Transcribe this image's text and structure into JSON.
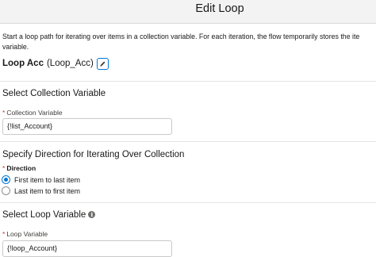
{
  "header": {
    "title": "Edit Loop"
  },
  "description": {
    "line1": "Start a loop path for iterating over items in a collection variable. For each iteration, the flow temporarily stores the ite",
    "line2": "variable."
  },
  "element": {
    "label": "Loop Acc",
    "api_name": "(Loop_Acc)"
  },
  "collection_section": {
    "title": "Select Collection Variable",
    "field_label": "Collection Variable",
    "value": "{!list_Account}"
  },
  "direction_section": {
    "title": "Specify Direction for Iterating Over Collection",
    "field_label": "Direction",
    "options": [
      {
        "label": "First item to last item",
        "selected": true
      },
      {
        "label": "Last item to first item",
        "selected": false
      }
    ]
  },
  "loop_variable_section": {
    "title": "Select Loop Variable",
    "info_icon": "info-icon",
    "field_label": "Loop Variable",
    "value": "{!loop_Account}"
  },
  "colors": {
    "accent": "#0176d3",
    "required": "#c23934",
    "header_bg": "#f3f3f3"
  }
}
